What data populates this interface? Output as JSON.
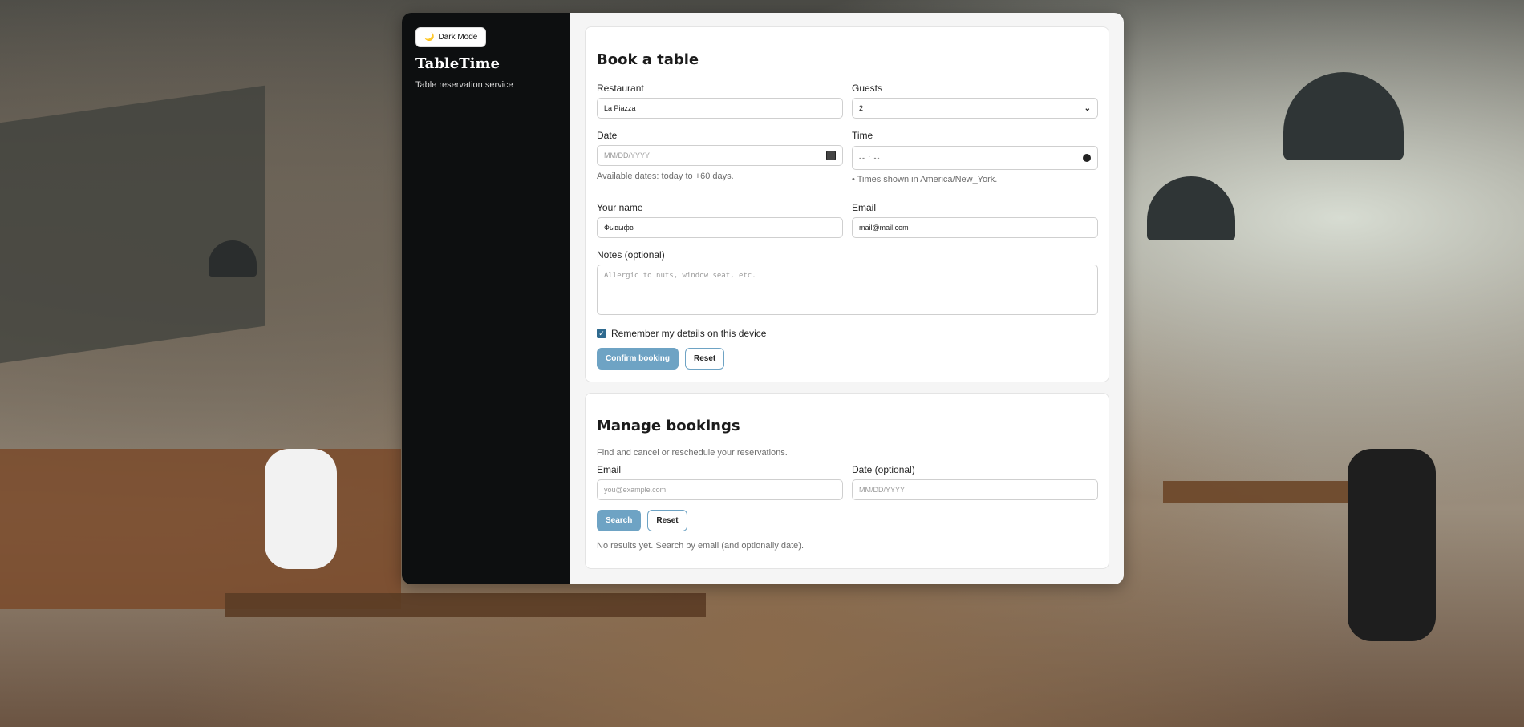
{
  "sidebar": {
    "theme_toggle_icon": "🌙",
    "theme_toggle_label": "Dark Mode",
    "brand": "TableTime",
    "tagline": "Table reservation service"
  },
  "booking": {
    "title": "Book a table",
    "restaurant_label": "Restaurant",
    "restaurant_value": "La Piazza",
    "guests_label": "Guests",
    "guests_value": "2",
    "date_label": "Date",
    "date_placeholder": "MM/DD/YYYY",
    "date_hint": "Available dates: today to +60 days.",
    "time_label": "Time",
    "time_placeholder": "-- : --",
    "time_hint": "• Times shown in America/New_York.",
    "name_label": "Your name",
    "name_value": "Фывыфв",
    "email_label": "Email",
    "email_value": "mail@mail.com",
    "notes_label": "Notes (optional)",
    "notes_placeholder": "Allergic to nuts, window seat, etc.",
    "remember_label": "Remember my details on this device",
    "remember_checked": true,
    "confirm_label": "Confirm booking",
    "reset_label": "Reset"
  },
  "manage": {
    "title": "Manage bookings",
    "description": "Find and cancel or reschedule your reservations.",
    "email_label": "Email",
    "email_placeholder": "you@example.com",
    "date_label": "Date (optional)",
    "date_placeholder": "MM/DD/YYYY",
    "search_label": "Search",
    "reset_label": "Reset",
    "results_text": "No results yet. Search by email (and optionally date)."
  },
  "colors": {
    "accent": "#6ea3c4",
    "sidebar_bg": "#0d0f10",
    "checkbox": "#2f6a8f"
  }
}
